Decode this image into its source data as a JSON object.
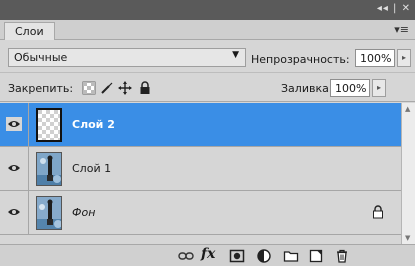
{
  "window": {
    "controls": "◂◂ | ✕"
  },
  "tabs": [
    {
      "label": "Слои"
    }
  ],
  "panel_menu_icon": "▾≡",
  "blend_mode": {
    "value": "Обычные"
  },
  "opacity": {
    "label": "Непрозрачность:",
    "value": "100%"
  },
  "lock": {
    "label": "Закрепить:",
    "icons": [
      "lock-transparent-pixels-icon",
      "lock-image-pixels-icon",
      "lock-position-icon",
      "lock-all-icon"
    ]
  },
  "fill": {
    "label": "Заливка:",
    "value": "100%"
  },
  "layers": [
    {
      "name": "Слой 2",
      "selected": true,
      "visible": true,
      "thumbnail": "transparent",
      "locked": false
    },
    {
      "name": "Слой 1",
      "selected": false,
      "visible": true,
      "thumbnail": "image",
      "locked": false
    },
    {
      "name": "Фон",
      "selected": false,
      "visible": true,
      "thumbnail": "image",
      "locked": true,
      "italic": true
    }
  ],
  "bottom_bar_icons": [
    "link-layers-icon",
    "fx-icon",
    "add-mask-icon",
    "adjustment-layer-icon",
    "new-group-icon",
    "new-layer-icon",
    "delete-layer-icon"
  ],
  "bottom_bar": {
    "fx_label": "fx"
  },
  "colors": {
    "selection": "#3a8ee6",
    "panel": "#d6d6d6"
  }
}
